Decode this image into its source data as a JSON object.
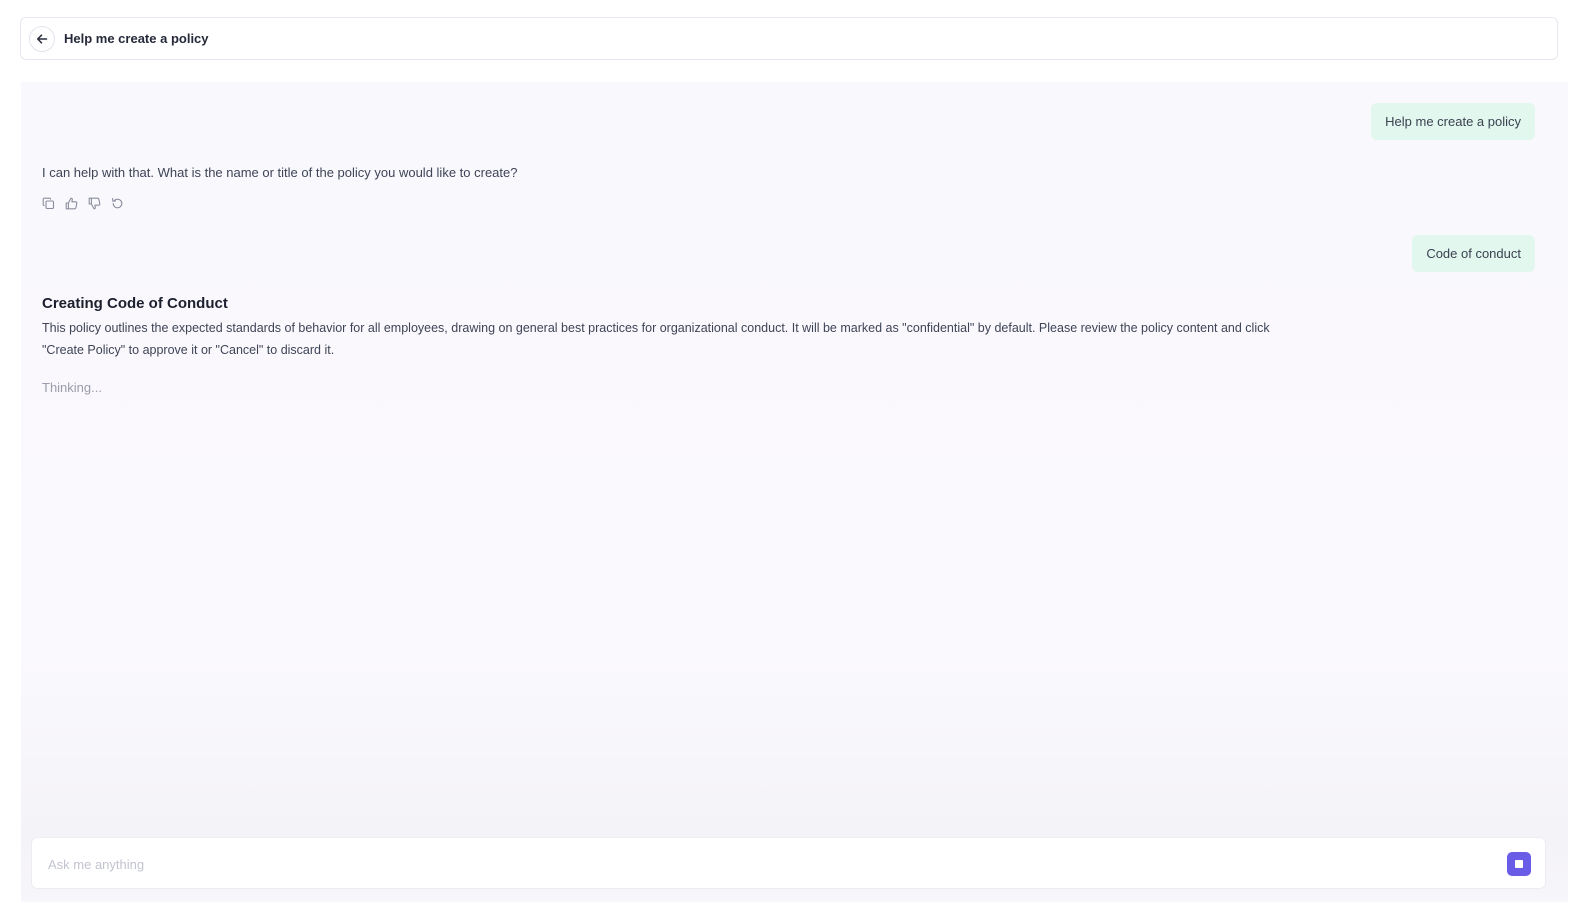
{
  "header": {
    "title": "Help me create a policy",
    "back_icon": "arrow-left-icon"
  },
  "conversation": {
    "user_message_1": "Help me create a policy",
    "assistant_message_1": "I can help with that. What is the name or title of the policy you would like to create?",
    "actions": [
      "copy-icon",
      "thumbs-up-icon",
      "thumbs-down-icon",
      "regenerate-icon"
    ],
    "user_message_2": "Code of conduct",
    "response_title": "Creating Code of Conduct",
    "response_body": "This policy outlines the expected standards of behavior for all employees, drawing on general best practices for organizational conduct. It will be marked as \"confidential\" by default. Please review the policy content and click \"Create Policy\" to approve it or \"Cancel\" to discard it.",
    "status": "Thinking..."
  },
  "composer": {
    "placeholder": "Ask me anything",
    "value": "",
    "stop_icon": "stop-icon"
  },
  "colors": {
    "accent": "#6b5ce7",
    "user_bubble": "#e2f7ed",
    "background": "#f9f8fd"
  }
}
